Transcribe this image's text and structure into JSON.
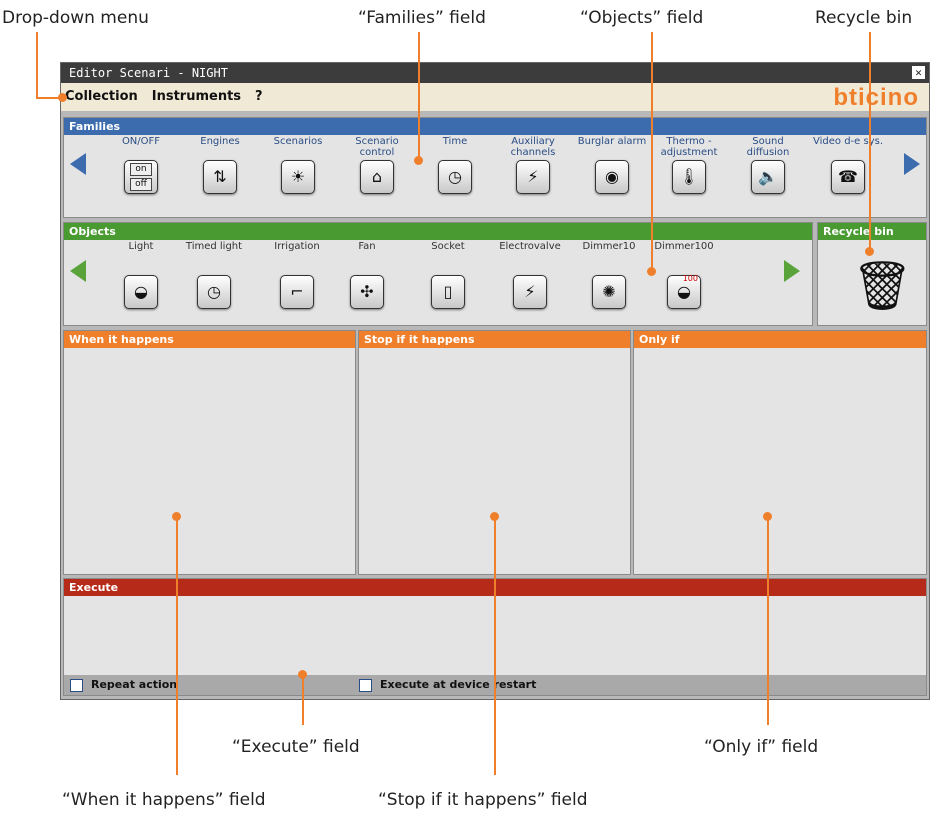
{
  "callouts": {
    "dropdown": "Drop-down menu",
    "families": "“Families” field",
    "objects": "“Objects” field",
    "recycle": "Recycle bin",
    "execute": "“Execute” field",
    "only_if": "“Only if” field",
    "when": "“When it happens” field",
    "stop": "“Stop if it happens” field"
  },
  "window": {
    "title": "Editor Scenari - NIGHT",
    "close": "✕"
  },
  "menu": {
    "items": [
      "Collection",
      "Instruments",
      "?"
    ],
    "logo": "bticino"
  },
  "families": {
    "header": "Families",
    "items": [
      {
        "label": "ON/OFF",
        "icon": "on-off-icon"
      },
      {
        "label": "Engines",
        "icon": "engines-icon"
      },
      {
        "label": "Scenarios",
        "icon": "scenarios-icon"
      },
      {
        "label": "Scenario control",
        "icon": "scenario-control-icon"
      },
      {
        "label": "Time",
        "icon": "clock-icon"
      },
      {
        "label": "Auxiliary channels",
        "icon": "lightning-icon"
      },
      {
        "label": "Burglar alarm",
        "icon": "alarm-icon"
      },
      {
        "label": "Thermo - adjustment",
        "icon": "thermometer-icon"
      },
      {
        "label": "Sound diffusion",
        "icon": "speaker-icon"
      },
      {
        "label": "Video d-e sys.",
        "icon": "intercom-icon"
      }
    ],
    "onoff": {
      "on": "on",
      "off": "off"
    }
  },
  "objects": {
    "header": "Objects",
    "items": [
      {
        "label": "Light",
        "icon": "light-icon"
      },
      {
        "label": "Timed light",
        "icon": "timed-light-icon"
      },
      {
        "label": "Irrigation",
        "icon": "faucet-icon"
      },
      {
        "label": "Fan",
        "icon": "fan-icon"
      },
      {
        "label": "Socket",
        "icon": "socket-icon"
      },
      {
        "label": "Electrovalve",
        "icon": "electrovalve-icon"
      },
      {
        "label": "Dimmer10",
        "icon": "dimmer10-icon"
      },
      {
        "label": "Dimmer100",
        "icon": "dimmer100-icon"
      }
    ],
    "dimmer_badge": "100"
  },
  "recycle": {
    "header": "Recycle bin"
  },
  "conditions": {
    "when": "When it happens",
    "stop": "Stop if it happens",
    "only_if": "Only if"
  },
  "execute": {
    "header": "Execute",
    "repeat": "Repeat action",
    "restart": "Execute at device restart"
  },
  "colors": {
    "accent": "#f07f2c",
    "families": "#3c6cae",
    "objects": "#4a9a32",
    "execute": "#b52a18"
  }
}
